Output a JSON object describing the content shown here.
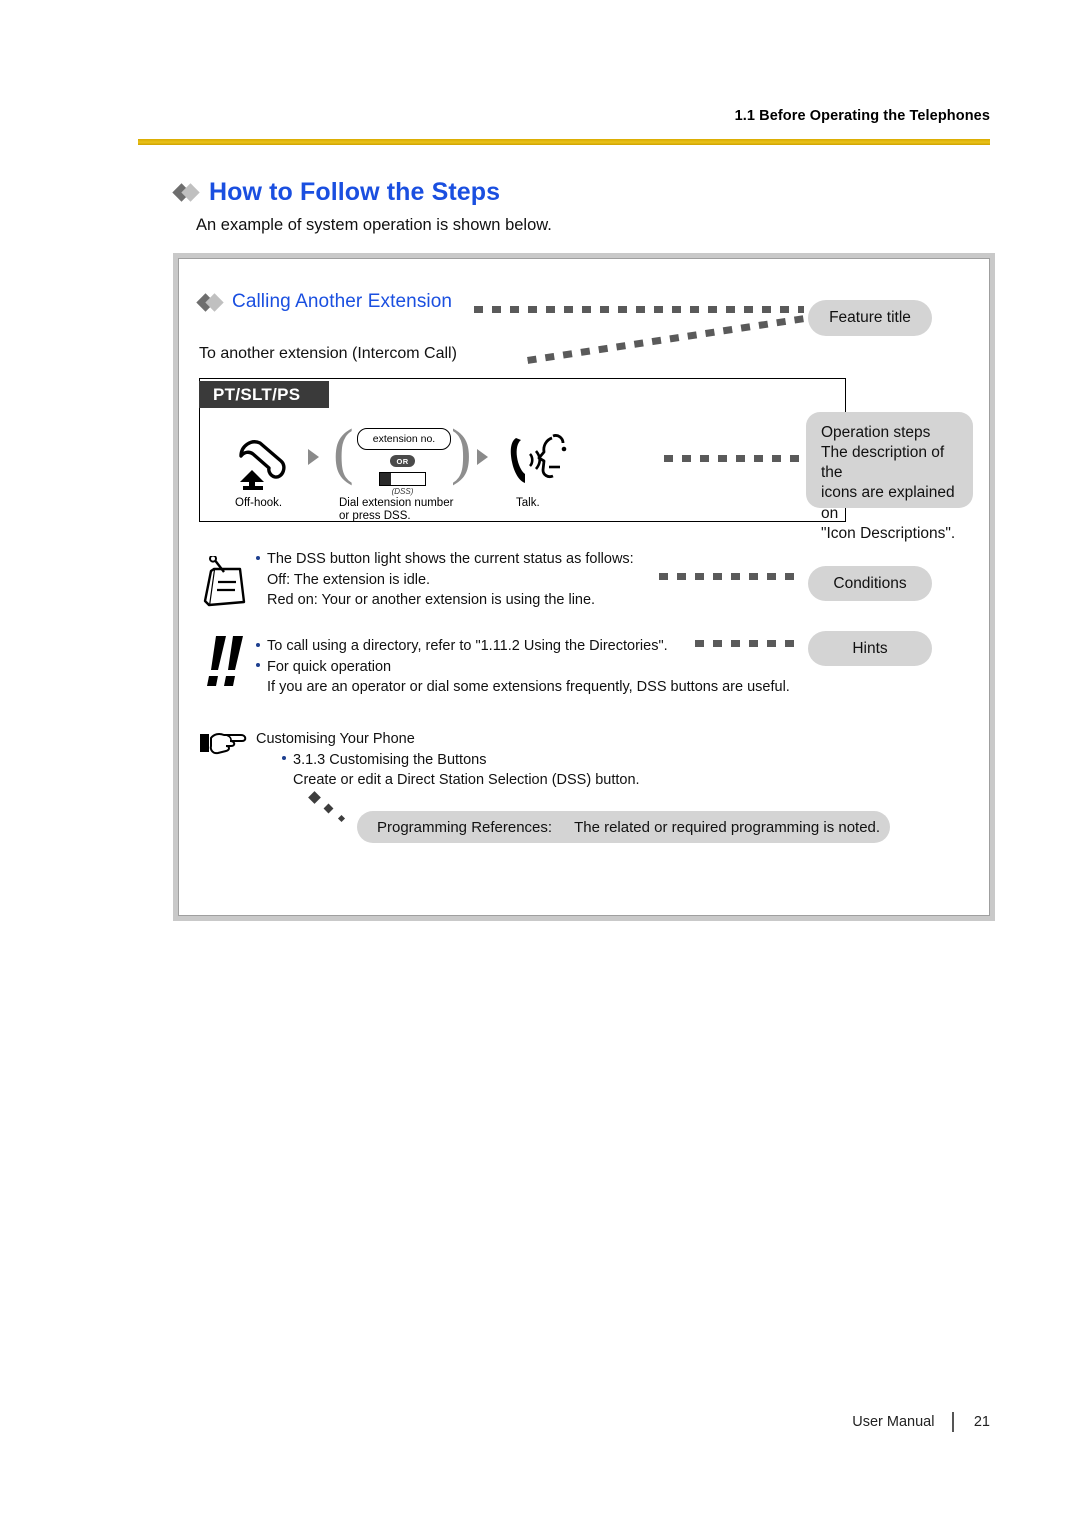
{
  "header": {
    "section": "1.1 Before Operating the Telephones"
  },
  "title": {
    "text": "How to Follow the Steps",
    "color": "#1a4fe0"
  },
  "intro": "An example of system operation is shown below.",
  "example": {
    "feature_heading": "Calling Another Extension",
    "feature_subheading": "To another extension (Intercom Call)",
    "operation_box": {
      "device_tab": "PT/SLT/PS",
      "steps": [
        {
          "caption": "Off-hook.",
          "icon": "offhook-handset-icon"
        },
        {
          "caption_line1": "Dial extension number",
          "caption_line2": "or press DSS.",
          "display_label": "extension no.",
          "or_label": "OR",
          "dss_label": "(DSS)",
          "icon": "dss-button-icon"
        },
        {
          "caption": "Talk.",
          "icon": "talk-handset-icon"
        }
      ]
    },
    "conditions": {
      "icon": "notepad-pencil-icon",
      "line1": "The DSS button light shows the current status as follows:",
      "line2": "Off:  The extension is idle.",
      "line3": "Red on:  Your or another extension is using the line."
    },
    "hints": {
      "icon": "double-exclamation-icon",
      "line1": "To call using a directory, refer to \"1.11.2 Using the Directories\".",
      "line2": "For quick operation",
      "line3": "If you are an operator or dial some extensions frequently, DSS buttons are useful."
    },
    "customising": {
      "icon": "pointing-hand-icon",
      "heading": "Customising Your Phone",
      "item": "3.1.3 Customising the Buttons",
      "detail": "Create or edit a Direct Station Selection (DSS) button."
    },
    "programming_references": {
      "label": "Programming References:",
      "text": "The related or required programming is noted."
    },
    "callouts": {
      "feature_title": "Feature title",
      "operation_steps_line1": "Operation steps",
      "operation_steps_line2": "The description of the",
      "operation_steps_line3": "icons are explained on",
      "operation_steps_line4": "\"Icon Descriptions\".",
      "conditions": "Conditions",
      "hints": "Hints"
    }
  },
  "footer": {
    "manual": "User Manual",
    "page": "21"
  }
}
